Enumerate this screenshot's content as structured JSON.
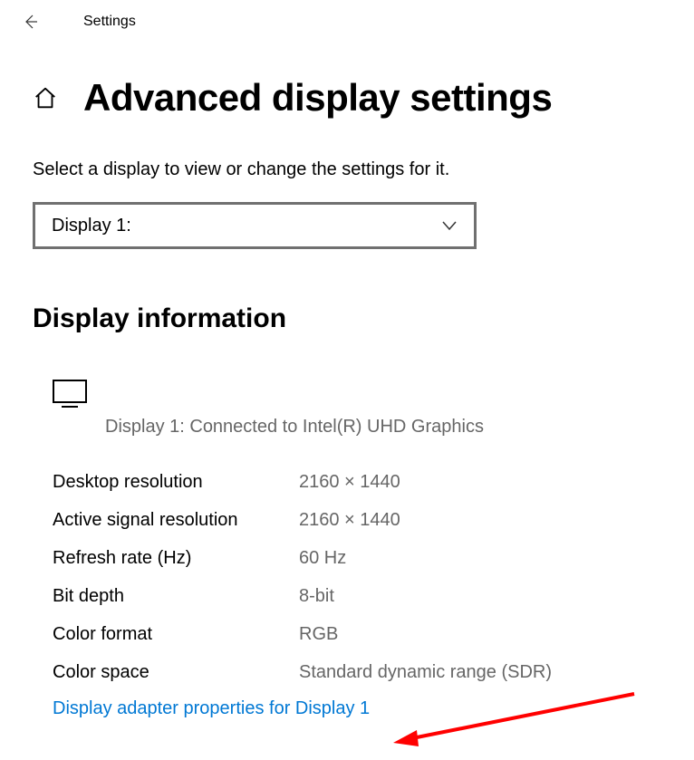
{
  "topbar": {
    "app_title": "Settings"
  },
  "header": {
    "page_title": "Advanced display settings"
  },
  "selector": {
    "label": "Select a display to view or change the settings for it.",
    "selected": "Display 1:"
  },
  "section": {
    "title": "Display information",
    "monitor_caption": "Display 1: Connected to Intel(R) UHD Graphics"
  },
  "info": {
    "rows": [
      {
        "label": "Desktop resolution",
        "value": "2160 × 1440"
      },
      {
        "label": "Active signal resolution",
        "value": "2160 × 1440"
      },
      {
        "label": "Refresh rate (Hz)",
        "value": "60 Hz"
      },
      {
        "label": "Bit depth",
        "value": "8-bit"
      },
      {
        "label": "Color format",
        "value": "RGB"
      },
      {
        "label": "Color space",
        "value": "Standard dynamic range (SDR)"
      }
    ]
  },
  "link": {
    "text": "Display adapter properties for Display 1"
  }
}
